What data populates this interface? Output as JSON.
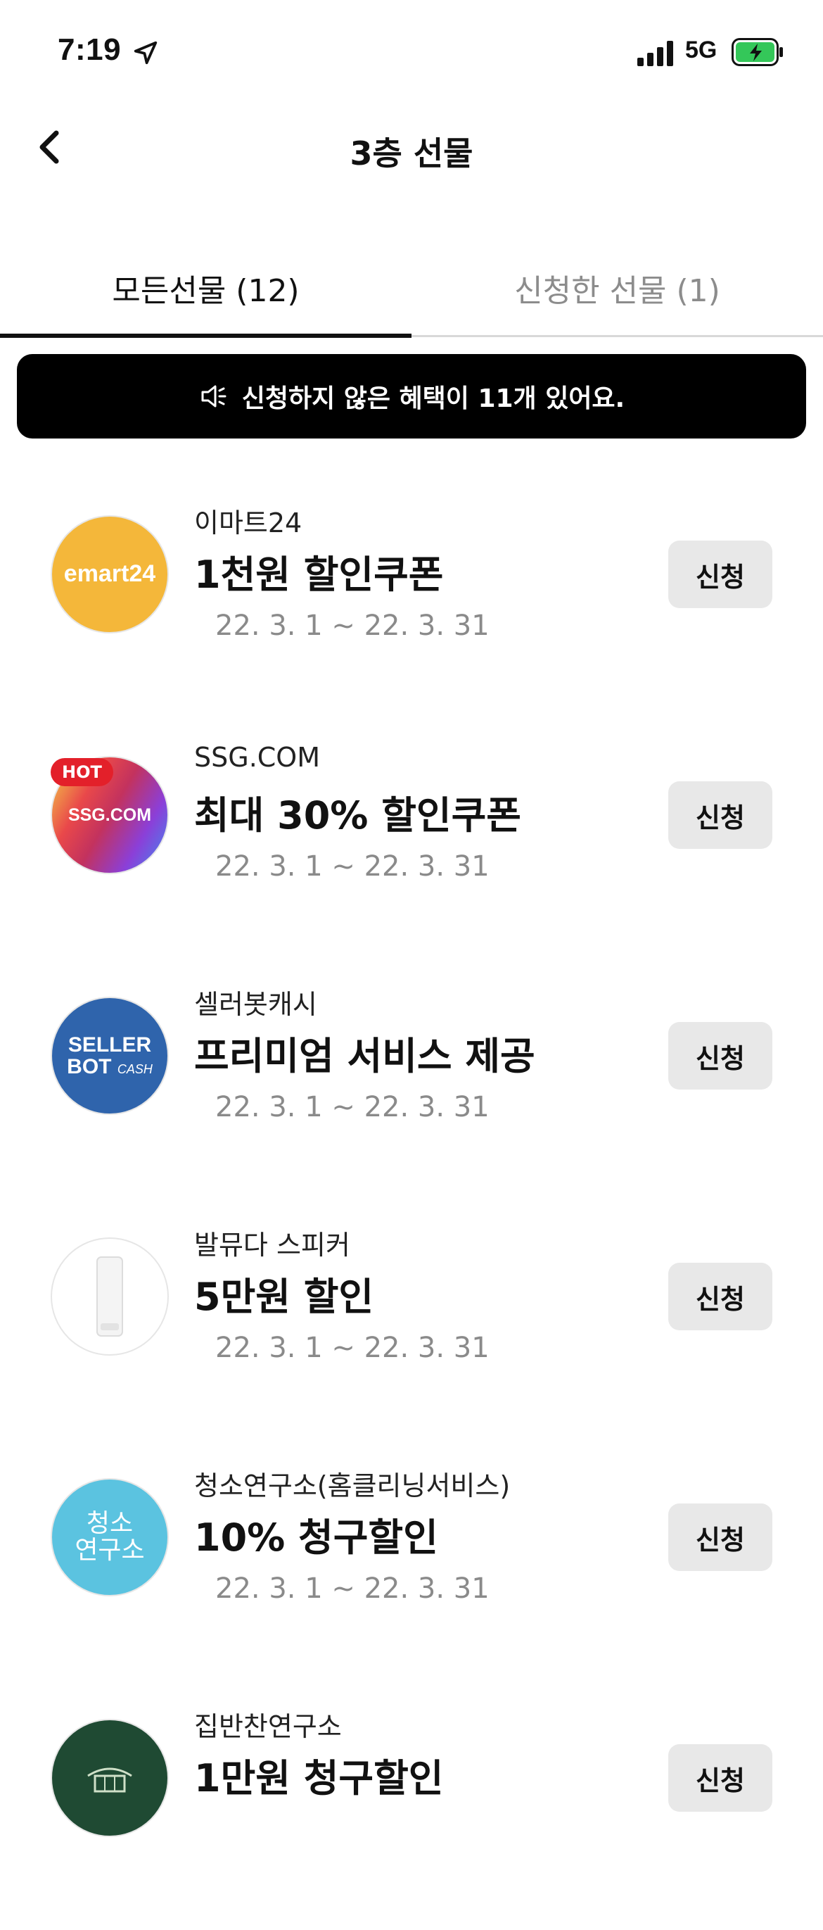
{
  "status_bar": {
    "time": "7:19",
    "network": "5G",
    "icons": [
      "location-arrow-icon",
      "signal-icon",
      "battery-charging-icon"
    ]
  },
  "nav": {
    "title": "3층 선물",
    "back_icon": "chevron-left-icon"
  },
  "tabs": [
    {
      "label": "모든선물 (12)",
      "active": true
    },
    {
      "label": "신청한 선물 (1)",
      "active": false
    }
  ],
  "notice": {
    "icon": "speaker-icon",
    "text": "신청하지 않은 혜택이 11개 있어요."
  },
  "items": [
    {
      "brand": "이마트24",
      "offer": "1천원 할인쿠폰",
      "period": "22. 3. 1 ~ 22. 3. 31",
      "button": "신청",
      "logo": {
        "text": "emart24",
        "bg": "#f4b73a"
      }
    },
    {
      "brand": "SSG.COM",
      "offer": "최대 30% 할인쿠폰",
      "period": "22. 3. 1 ~ 22. 3. 31",
      "button": "신청",
      "badge": "HOT",
      "logo": {
        "text": "SSG.COM",
        "bg": "#e86a3c"
      }
    },
    {
      "brand": "셀러봇캐시",
      "offer": "프리미엄 서비스 제공",
      "period": "22. 3. 1 ~ 22. 3. 31",
      "button": "신청",
      "logo": {
        "line1": "SELLER",
        "line2": "BOT",
        "line3": "CASH",
        "bg": "#2f64ac"
      }
    },
    {
      "brand": "발뮤다 스피커",
      "offer": "5만원 할인",
      "period": "22. 3. 1 ~ 22. 3. 31",
      "button": "신청",
      "logo": {
        "bg": "#ffffff"
      }
    },
    {
      "brand": "청소연구소(홈클리닝서비스)",
      "offer": "10% 청구할인",
      "period": "22. 3. 1 ~ 22. 3. 31",
      "button": "신청",
      "logo": {
        "line1": "청소",
        "line2": "연구소",
        "bg": "#5bc3e0"
      }
    },
    {
      "brand": "집반찬연구소",
      "offer": "1만원 청구할인",
      "button": "신청",
      "logo": {
        "bg": "#1f4a33"
      }
    }
  ],
  "colors": {
    "banner_bg": "#000000",
    "button_bg": "#e8e8e8",
    "inactive_tab": "#8c8c8c",
    "period_text": "#8a8a8a",
    "hot_badge": "#e3202a",
    "battery_fill": "#34c759"
  }
}
